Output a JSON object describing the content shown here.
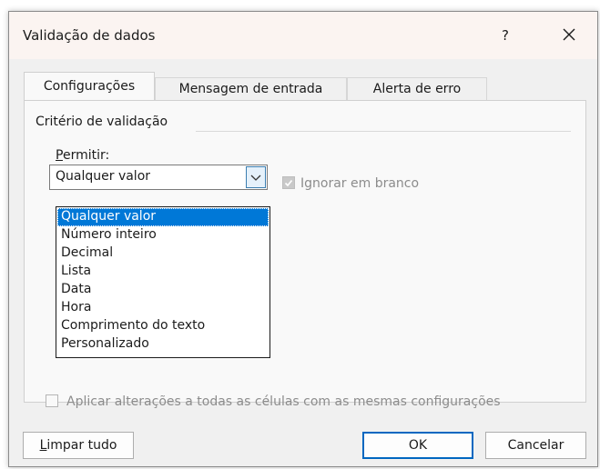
{
  "dialog": {
    "title": "Validação de dados",
    "help_label": "?",
    "tabs": [
      {
        "label": "Configurações",
        "active": true
      },
      {
        "label": "Mensagem de entrada",
        "active": false
      },
      {
        "label": "Alerta de erro",
        "active": false
      }
    ],
    "settings": {
      "group_label": "Critério de validação",
      "allow_label_first": "P",
      "allow_label_rest": "ermitir:",
      "allow_value": "Qualquer valor",
      "ignore_blank_label": "Ignorar em branco",
      "ignore_blank_checked": true,
      "ignore_blank_disabled": true,
      "options": [
        "Qualquer valor",
        "Número inteiro",
        "Decimal",
        "Lista",
        "Data",
        "Hora",
        "Comprimento do texto",
        "Personalizado"
      ],
      "selected_option": "Qualquer valor",
      "apply_all_label": "Aplicar alterações a todas as células com as mesmas configurações",
      "apply_all_checked": false
    },
    "buttons": {
      "clear_first": "L",
      "clear_rest": "impar tudo",
      "ok": "OK",
      "cancel": "Cancelar"
    }
  },
  "colors": {
    "accent": "#0078d7",
    "dialog_bg": "#f0f0f0",
    "titlebar_bg": "#fbf4f1"
  }
}
